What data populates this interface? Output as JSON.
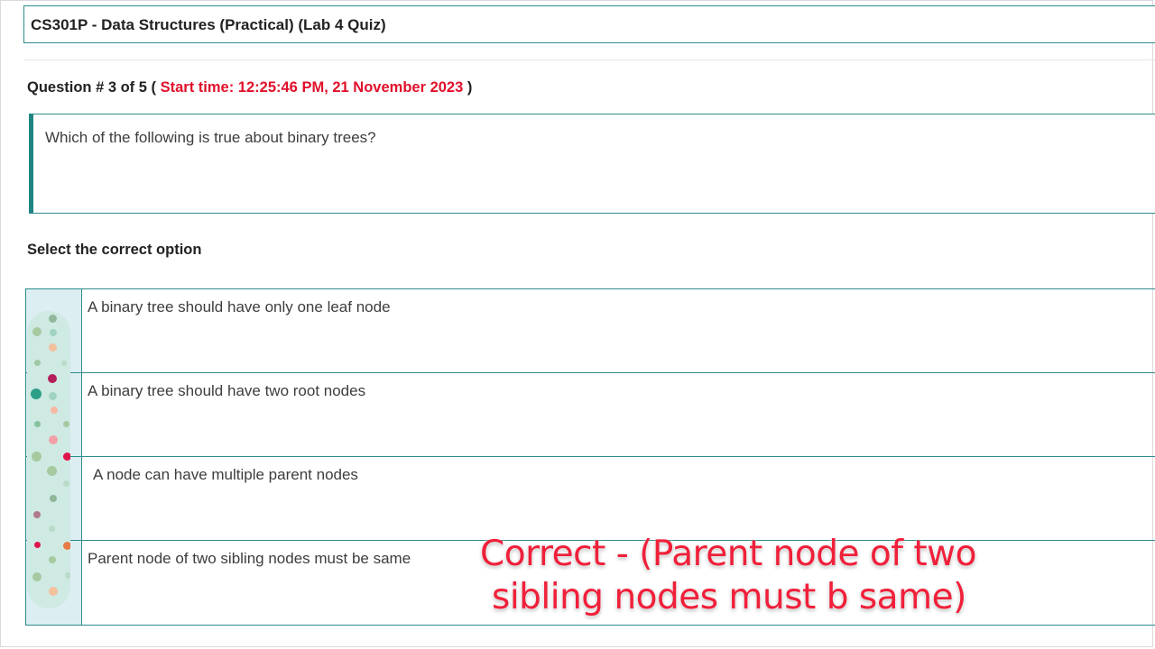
{
  "quiz": {
    "title": "CS301P - Data Structures (Practical) (Lab 4 Quiz)"
  },
  "question": {
    "number_label": "Question # 3 of 5 (",
    "start_time_label": "Start time: 12:25:46 PM, 21 November 2023",
    "close_paren": ")",
    "text": "Which of the following is true about binary trees?"
  },
  "select_label": "Select the correct option",
  "options": [
    {
      "label": "A binary tree should have only one leaf node"
    },
    {
      "label": "A binary tree should have two root nodes"
    },
    {
      "label": "A node can have multiple parent nodes"
    },
    {
      "label": "Parent node of two sibling nodes must be same"
    }
  ],
  "overlay": {
    "line1": "Correct - (Parent node of two",
    "line2": "sibling nodes must b same)"
  },
  "colors": {
    "accent": "#2e8b8b",
    "start_time": "#e0102a",
    "overlay_text": "#f0203a",
    "option_column": "#ddeef3"
  }
}
